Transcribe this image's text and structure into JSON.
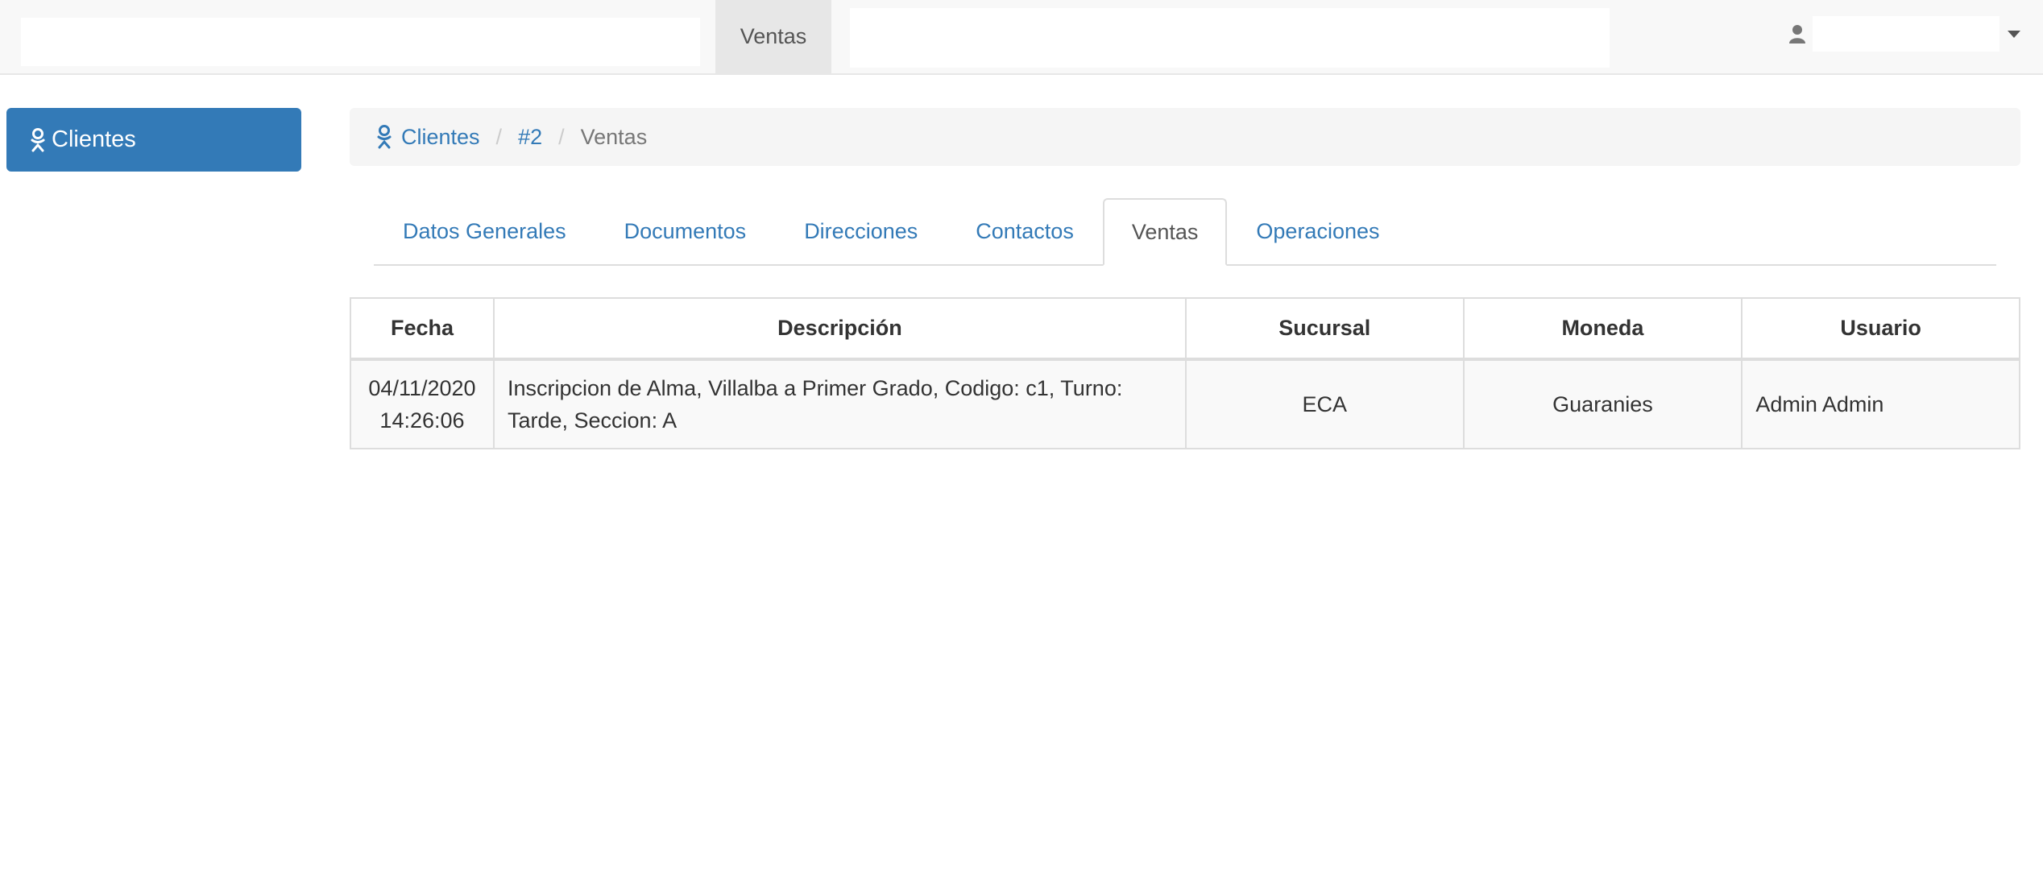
{
  "topnav": {
    "active_item": "Ventas"
  },
  "sidebar": {
    "items": [
      {
        "label": "Clientes",
        "icon": "odnoklassniki-icon"
      }
    ]
  },
  "breadcrumb": {
    "items": [
      {
        "label": "Clientes",
        "icon": "odnoklassniki-icon"
      },
      {
        "label": "#2"
      },
      {
        "label": "Ventas"
      }
    ],
    "separator": "/"
  },
  "tabs": [
    {
      "label": "Datos Generales",
      "active": false
    },
    {
      "label": "Documentos",
      "active": false
    },
    {
      "label": "Direcciones",
      "active": false
    },
    {
      "label": "Contactos",
      "active": false
    },
    {
      "label": "Ventas",
      "active": true
    },
    {
      "label": "Operaciones",
      "active": false
    }
  ],
  "table": {
    "headers": [
      "Fecha",
      "Descripción",
      "Sucursal",
      "Moneda",
      "Usuario"
    ],
    "rows": [
      {
        "fecha_date": "04/11/2020",
        "fecha_time": "14:26:06",
        "descripcion": "Inscripcion de Alma, Villalba a Primer Grado, Codigo: c1, Turno: Tarde, Seccion: A",
        "sucursal": "ECA",
        "moneda": "Guaranies",
        "usuario": "Admin Admin"
      }
    ]
  },
  "colors": {
    "primary": "#337ab7",
    "navbar_bg": "#f8f8f8",
    "breadcrumb_bg": "#f5f5f5",
    "border": "#dddddd"
  }
}
